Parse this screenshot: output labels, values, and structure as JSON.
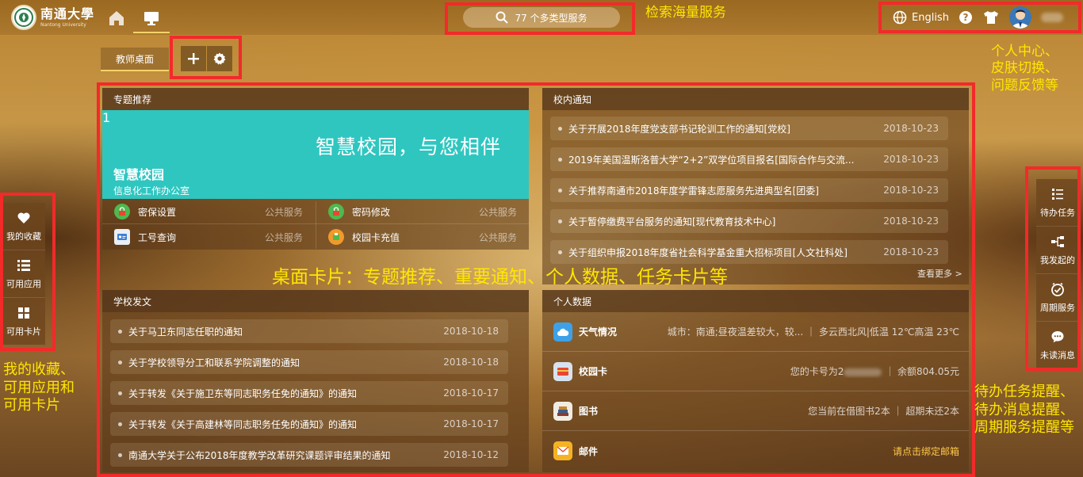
{
  "header": {
    "logo_cn": "南通大學",
    "logo_en": "Nantong University",
    "search_placeholder": "77 个多类型服务",
    "lang_label": "English"
  },
  "annotations": {
    "search_note": "检索海量服务",
    "topright_note": [
      "个人中心、",
      "皮肤切换、",
      "问题反馈等"
    ],
    "left_note": [
      "我的收藏、",
      "可用应用和",
      "可用卡片"
    ],
    "center_note": "桌面卡片：专题推荐、重要通知、个人数据、任务卡片等",
    "right_note": [
      "待办任务提醒、",
      "待办消息提醒、",
      "周期服务提醒等"
    ]
  },
  "desktop": {
    "tab_label": "教师桌面"
  },
  "topic_card": {
    "title": "专题推荐",
    "badge": "1",
    "banner_slogan": "智慧校园，与您相伴",
    "banner_title": "智慧校园",
    "banner_sub": "信息化工作办公室",
    "services": [
      {
        "name": "密保设置",
        "category": "公共服务"
      },
      {
        "name": "密码修改",
        "category": "公共服务"
      },
      {
        "name": "工号查询",
        "category": "公共服务"
      },
      {
        "name": "校园卡充值",
        "category": "公共服务"
      }
    ]
  },
  "notice_card": {
    "title": "校内通知",
    "more": "查看更多 >",
    "items": [
      {
        "title": "关于开展2018年度党支部书记轮训工作的通知[党校]",
        "date": "2018-10-23"
      },
      {
        "title": "2019年美国温斯洛普大学“2+2”双学位项目报名[国际合作与交流...",
        "date": "2018-10-23"
      },
      {
        "title": "关于推荐南通市2018年度学雷锋志愿服务先进典型名[团委]",
        "date": "2018-10-23"
      },
      {
        "title": "关于暂停缴费平台服务的通知[现代教育技术中心]",
        "date": "2018-10-23"
      },
      {
        "title": "关于组织申报2018年度省社会科学基金重大招标项目[人文社科处]",
        "date": "2018-10-23"
      }
    ]
  },
  "doc_card": {
    "title": "学校发文",
    "items": [
      {
        "title": "关于马卫东同志任职的通知",
        "date": "2018-10-18"
      },
      {
        "title": "关于学校领导分工和联系学院调整的通知",
        "date": "2018-10-18"
      },
      {
        "title": "关于转发《关于施卫东等同志职务任免的通知》的通知",
        "date": "2018-10-17"
      },
      {
        "title": "关于转发《关于高建林等同志职务任免的通知》的通知",
        "date": "2018-10-17"
      },
      {
        "title": "南通大学关于公布2018年度教学改革研究课题评审结果的通知",
        "date": "2018-10-12"
      }
    ]
  },
  "personal_card": {
    "title": "个人数据",
    "rows": [
      {
        "name": "天气情况",
        "info": "城市：南通;昼夜温差较大，较...  ｜  多云西北风|低温 12℃高温 23℃"
      },
      {
        "name": "校园卡",
        "info_a": "您的卡号为2",
        "info_b": "｜  余额804.05元"
      },
      {
        "name": "图书",
        "info": "您当前在借图书2本  ｜  超期未还2本"
      },
      {
        "name": "邮件",
        "info": "请点击绑定邮箱"
      }
    ]
  },
  "left_dock": [
    {
      "label": "我的收藏",
      "icon": "heart-icon"
    },
    {
      "label": "可用应用",
      "icon": "list-icon"
    },
    {
      "label": "可用卡片",
      "icon": "grid-icon"
    }
  ],
  "right_dock": [
    {
      "label": "待办任务",
      "icon": "task-list-icon"
    },
    {
      "label": "我发起的",
      "icon": "share-icon"
    },
    {
      "label": "周期服务",
      "icon": "clock-check-icon"
    },
    {
      "label": "未读消息",
      "icon": "chat-icon"
    }
  ],
  "colors": {
    "annotation_red": "#f22a2a",
    "annotation_text": "#ffe600",
    "accent_underline": "#f5d26b",
    "mail_link": "#ffc94a"
  }
}
